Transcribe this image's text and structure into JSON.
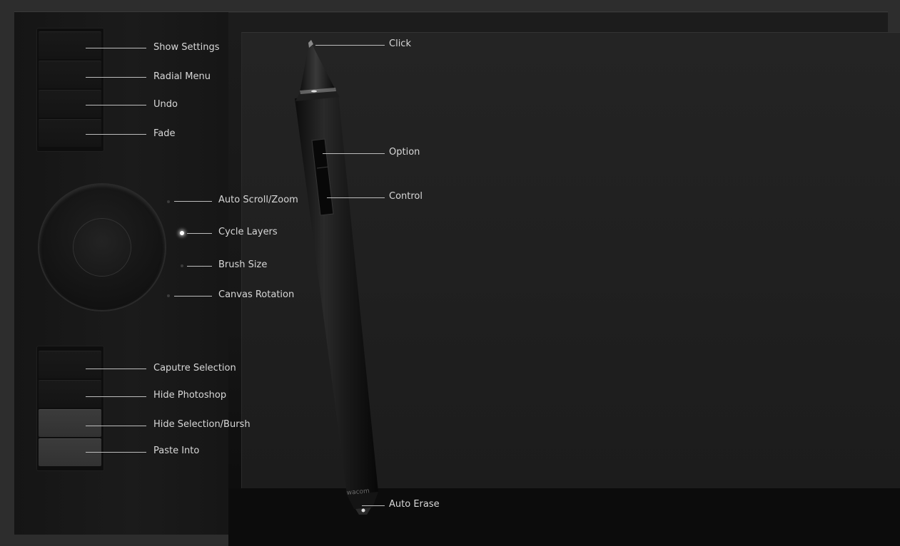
{
  "express_keys_top": [
    {
      "label": "Show Settings"
    },
    {
      "label": "Radial Menu"
    },
    {
      "label": "Undo"
    },
    {
      "label": "Fade"
    }
  ],
  "touch_ring": [
    {
      "label": "Auto Scroll/Zoom",
      "active": false
    },
    {
      "label": "Cycle Layers",
      "active": true
    },
    {
      "label": "Brush Size",
      "active": false
    },
    {
      "label": "Canvas Rotation",
      "active": false
    }
  ],
  "express_keys_bottom": [
    {
      "label": "Caputre Selection"
    },
    {
      "label": "Hide Photoshop"
    },
    {
      "label": "Hide Selection/Bursh"
    },
    {
      "label": "Paste Into"
    }
  ],
  "pen": {
    "tip_label": "Click",
    "upper_side_switch_label": "Option",
    "lower_side_switch_label": "Control",
    "eraser_label": "Auto Erase",
    "brand_text": "wacom"
  },
  "colors": {
    "label_text": "#d8d8d8",
    "leader_line": "#bdbdbd",
    "active_led": "#ffffff"
  }
}
